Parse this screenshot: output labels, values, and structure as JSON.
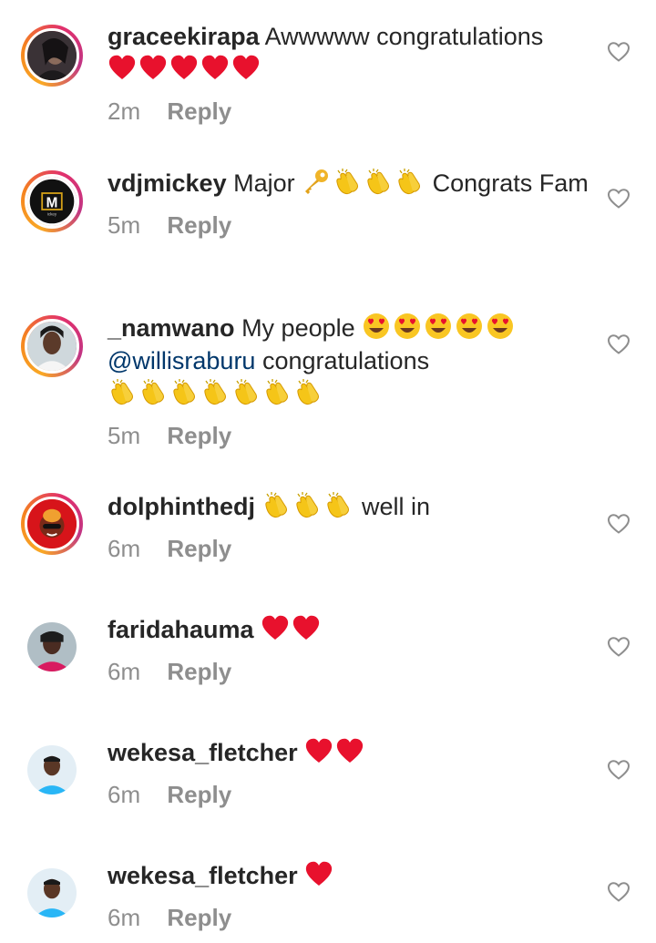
{
  "comments": [
    {
      "username": "graceekirapa",
      "text_before": "Awwwww congratulations",
      "emojis": [
        "heart",
        "heart",
        "heart",
        "heart",
        "heart"
      ],
      "emoji_position": "after",
      "text_after": "",
      "time": "2m",
      "reply": "Reply",
      "avatar": "avatar-photo-dark"
    },
    {
      "username": "vdjmickey",
      "text_before": "Major",
      "emojis": [
        "key",
        "clap",
        "clap",
        "clap"
      ],
      "text_after": "Congrats Fam",
      "time": "5m",
      "reply": "Reply",
      "avatar": "avatar-logo-m"
    },
    {
      "username": "_namwano",
      "text_before": "My people",
      "emojis": [
        "heart-eyes",
        "heart-eyes",
        "heart-eyes",
        "heart-eyes",
        "heart-eyes"
      ],
      "mention": "@willisraburu",
      "text_after": "congratulations",
      "emojis2": [
        "clap",
        "clap",
        "clap",
        "clap",
        "clap",
        "clap",
        "clap"
      ],
      "time": "5m",
      "reply": "Reply",
      "avatar": "avatar-photo-woman"
    },
    {
      "username": "dolphinthedj",
      "text_before": "",
      "emojis": [
        "clap",
        "clap",
        "clap"
      ],
      "text_after": "well in",
      "time": "6m",
      "reply": "Reply",
      "avatar": "avatar-dj-red"
    },
    {
      "username": "faridahauma",
      "text_before": "",
      "emojis": [
        "heart",
        "heart"
      ],
      "text_after": "",
      "time": "6m",
      "reply": "Reply",
      "avatar": "avatar-photo-woman-2"
    },
    {
      "username": "wekesa_fletcher",
      "text_before": "",
      "emojis": [
        "heart",
        "heart"
      ],
      "text_after": "",
      "time": "6m",
      "reply": "Reply",
      "avatar": "avatar-photo-man"
    },
    {
      "username": "wekesa_fletcher",
      "text_before": "",
      "emojis": [
        "heart"
      ],
      "text_after": "",
      "time": "6m",
      "reply": "Reply",
      "avatar": "avatar-photo-man"
    }
  ],
  "colors": {
    "text": "#262626",
    "meta": "#8e8e8e",
    "mention": "#00376b",
    "heart_red": "#e8112d",
    "clap_yellow": "#f5c518"
  },
  "icons": {
    "like": "heart-outline-icon"
  }
}
